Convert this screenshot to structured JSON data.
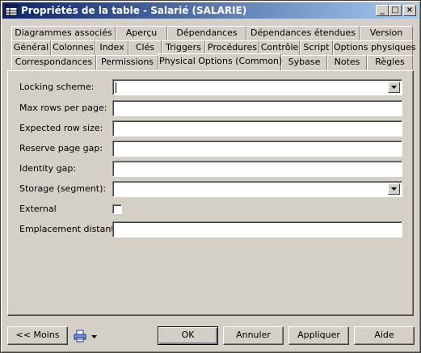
{
  "window": {
    "title": "Propriétés de la table - Salarié (SALARIE)"
  },
  "titlebar_buttons": {
    "minimize": "_",
    "maximize": "□",
    "close": "×"
  },
  "tabs": {
    "row1": [
      "Diagrammes associés",
      "Aperçu",
      "Dépendances",
      "Dépendances étendues",
      "Version"
    ],
    "row2": [
      "Général",
      "Colonnes",
      "Index",
      "Clés",
      "Triggers",
      "Procédures",
      "Contrôle",
      "Script",
      "Options physiques"
    ],
    "row3": [
      "Correspondances",
      "Permissions",
      "Physical Options (Common)",
      "Sybase",
      "Notes",
      "Règles"
    ]
  },
  "form": {
    "locking_scheme": {
      "label": "Locking scheme:",
      "value": ""
    },
    "max_rows": {
      "label": "Max rows per page:",
      "value": ""
    },
    "expected_row_size": {
      "label": "Expected row size:",
      "value": ""
    },
    "reserve_page_gap": {
      "label": "Reserve page gap:",
      "value": ""
    },
    "identity_gap": {
      "label": "Identity gap:",
      "value": ""
    },
    "storage": {
      "label": "Storage (segment):",
      "value": ""
    },
    "external": {
      "label": "External",
      "checked": false
    },
    "remote_location": {
      "label": "Emplacement distant :",
      "value": ""
    }
  },
  "buttons": {
    "less": "<< Moins",
    "ok": "OK",
    "cancel": "Annuler",
    "apply": "Appliquer",
    "help": "Aide"
  },
  "icons": {
    "app": "table-icon",
    "tools": "print-icon"
  }
}
